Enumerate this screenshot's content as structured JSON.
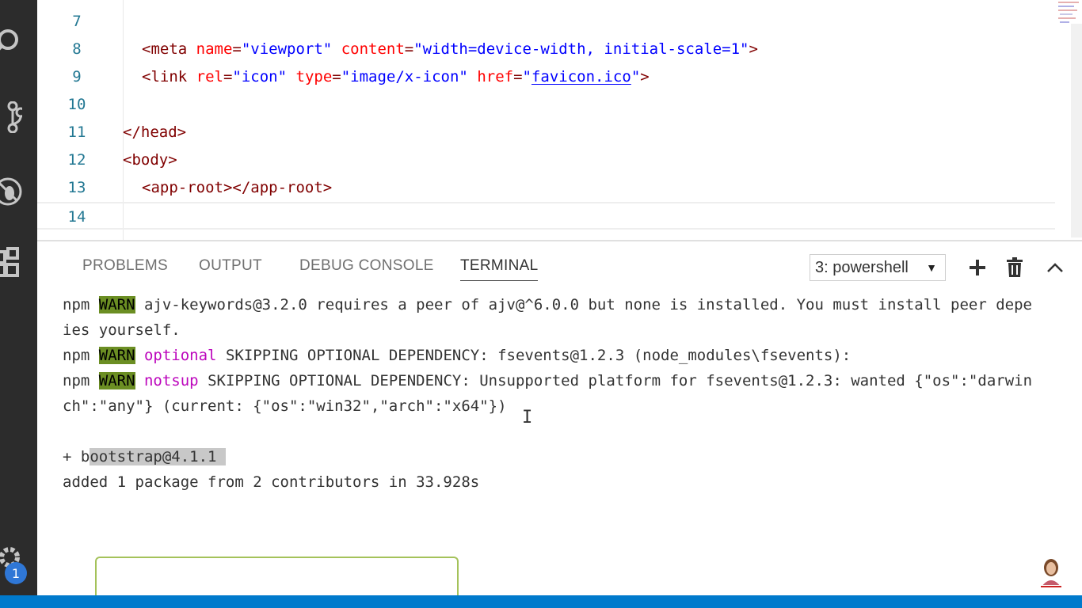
{
  "editor": {
    "lines": [
      {
        "num": "7"
      },
      {
        "num": "8",
        "parts": [
          {
            "t": "<meta ",
            "c": "tag"
          },
          {
            "t": "name",
            "c": "attr"
          },
          {
            "t": "=",
            "c": "tag"
          },
          {
            "t": "\"viewport\"",
            "c": "str"
          },
          {
            "t": " content",
            "c": "attr"
          },
          {
            "t": "=",
            "c": "tag"
          },
          {
            "t": "\"width=device-width, initial-scale=1\"",
            "c": "str"
          },
          {
            "t": ">",
            "c": "tag"
          }
        ]
      },
      {
        "num": "9",
        "parts": [
          {
            "t": "<link ",
            "c": "tag"
          },
          {
            "t": "rel",
            "c": "attr"
          },
          {
            "t": "=",
            "c": "tag"
          },
          {
            "t": "\"icon\"",
            "c": "str"
          },
          {
            "t": " type",
            "c": "attr"
          },
          {
            "t": "=",
            "c": "tag"
          },
          {
            "t": "\"image/x-icon\"",
            "c": "str"
          },
          {
            "t": " href",
            "c": "attr"
          },
          {
            "t": "=",
            "c": "tag"
          },
          {
            "t": "\"",
            "c": "str"
          },
          {
            "t": "favicon.ico",
            "c": "link"
          },
          {
            "t": "\"",
            "c": "str"
          },
          {
            "t": ">",
            "c": "tag"
          }
        ]
      },
      {
        "num": "10"
      },
      {
        "num": "11",
        "parts": [
          {
            "t": "</head>",
            "c": "tag"
          }
        ]
      },
      {
        "num": "12",
        "parts": [
          {
            "t": "<body>",
            "c": "tag"
          }
        ]
      },
      {
        "num": "13",
        "parts": [
          {
            "t": "<app-root></app-root>",
            "c": "tag"
          }
        ]
      },
      {
        "num": "14"
      }
    ]
  },
  "panel": {
    "tabs": [
      {
        "label": "PROBLEMS"
      },
      {
        "label": "OUTPUT"
      },
      {
        "label": "DEBUG CONSOLE"
      },
      {
        "label": "TERMINAL",
        "active": true
      }
    ],
    "terminal_select": "3: powershell",
    "actions": [
      "plus-icon",
      "trash-icon",
      "chevron-up-icon"
    ]
  },
  "terminal": {
    "lines": [
      [
        {
          "t": "npm "
        },
        {
          "t": "WARN",
          "c": "warn"
        },
        {
          "t": " ajv-keywords@3.2.0 requires a peer of ajv@^6.0.0 but none is installed. You must install peer depe"
        }
      ],
      [
        {
          "t": "ies yourself."
        }
      ],
      [
        {
          "t": "npm "
        },
        {
          "t": "WARN",
          "c": "warn"
        },
        {
          "t": " "
        },
        {
          "t": "optional",
          "c": "magenta"
        },
        {
          "t": " SKIPPING OPTIONAL DEPENDENCY: fsevents@1.2.3 (node_modules\\fsevents):"
        }
      ],
      [
        {
          "t": "npm "
        },
        {
          "t": "WARN",
          "c": "warn"
        },
        {
          "t": " "
        },
        {
          "t": "notsup",
          "c": "magenta"
        },
        {
          "t": " SKIPPING OPTIONAL DEPENDENCY: Unsupported platform for fsevents@1.2.3: wanted {\"os\":\"darwin"
        }
      ],
      [
        {
          "t": "ch\":\"any\"} (current: {\"os\":\"win32\",\"arch\":\"x64\"})"
        }
      ],
      [],
      [
        {
          "t": "+ b"
        },
        {
          "t": "ootstrap@4.1.1 ",
          "c": "sel"
        }
      ],
      [
        {
          "t": "added 1 package from 2 contributors in 33.928s"
        }
      ]
    ]
  },
  "activity": {
    "icons": [
      "search-icon",
      "source-control-icon",
      "debug-icon",
      "extensions-icon",
      "gear-icon"
    ],
    "badge": "1"
  },
  "colors": {
    "tag": "#800000",
    "attr": "#ff0000",
    "string": "#0000ff",
    "warn_bg": "#6b8e23",
    "magenta": "#bc05bc",
    "status_bar": "#007acc"
  }
}
